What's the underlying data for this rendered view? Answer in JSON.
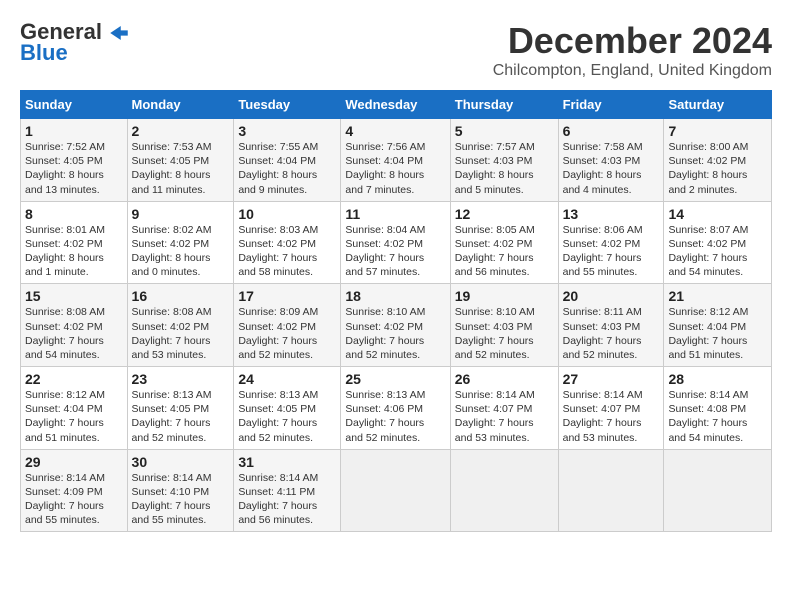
{
  "header": {
    "logo_line1": "General",
    "logo_line2": "Blue",
    "title": "December 2024",
    "subtitle": "Chilcompton, England, United Kingdom"
  },
  "calendar": {
    "days_of_week": [
      "Sunday",
      "Monday",
      "Tuesday",
      "Wednesday",
      "Thursday",
      "Friday",
      "Saturday"
    ],
    "weeks": [
      [
        {
          "day": "1",
          "info": "Sunrise: 7:52 AM\nSunset: 4:05 PM\nDaylight: 8 hours\nand 13 minutes."
        },
        {
          "day": "2",
          "info": "Sunrise: 7:53 AM\nSunset: 4:05 PM\nDaylight: 8 hours\nand 11 minutes."
        },
        {
          "day": "3",
          "info": "Sunrise: 7:55 AM\nSunset: 4:04 PM\nDaylight: 8 hours\nand 9 minutes."
        },
        {
          "day": "4",
          "info": "Sunrise: 7:56 AM\nSunset: 4:04 PM\nDaylight: 8 hours\nand 7 minutes."
        },
        {
          "day": "5",
          "info": "Sunrise: 7:57 AM\nSunset: 4:03 PM\nDaylight: 8 hours\nand 5 minutes."
        },
        {
          "day": "6",
          "info": "Sunrise: 7:58 AM\nSunset: 4:03 PM\nDaylight: 8 hours\nand 4 minutes."
        },
        {
          "day": "7",
          "info": "Sunrise: 8:00 AM\nSunset: 4:02 PM\nDaylight: 8 hours\nand 2 minutes."
        }
      ],
      [
        {
          "day": "8",
          "info": "Sunrise: 8:01 AM\nSunset: 4:02 PM\nDaylight: 8 hours\nand 1 minute."
        },
        {
          "day": "9",
          "info": "Sunrise: 8:02 AM\nSunset: 4:02 PM\nDaylight: 8 hours\nand 0 minutes."
        },
        {
          "day": "10",
          "info": "Sunrise: 8:03 AM\nSunset: 4:02 PM\nDaylight: 7 hours\nand 58 minutes."
        },
        {
          "day": "11",
          "info": "Sunrise: 8:04 AM\nSunset: 4:02 PM\nDaylight: 7 hours\nand 57 minutes."
        },
        {
          "day": "12",
          "info": "Sunrise: 8:05 AM\nSunset: 4:02 PM\nDaylight: 7 hours\nand 56 minutes."
        },
        {
          "day": "13",
          "info": "Sunrise: 8:06 AM\nSunset: 4:02 PM\nDaylight: 7 hours\nand 55 minutes."
        },
        {
          "day": "14",
          "info": "Sunrise: 8:07 AM\nSunset: 4:02 PM\nDaylight: 7 hours\nand 54 minutes."
        }
      ],
      [
        {
          "day": "15",
          "info": "Sunrise: 8:08 AM\nSunset: 4:02 PM\nDaylight: 7 hours\nand 54 minutes."
        },
        {
          "day": "16",
          "info": "Sunrise: 8:08 AM\nSunset: 4:02 PM\nDaylight: 7 hours\nand 53 minutes."
        },
        {
          "day": "17",
          "info": "Sunrise: 8:09 AM\nSunset: 4:02 PM\nDaylight: 7 hours\nand 52 minutes."
        },
        {
          "day": "18",
          "info": "Sunrise: 8:10 AM\nSunset: 4:02 PM\nDaylight: 7 hours\nand 52 minutes."
        },
        {
          "day": "19",
          "info": "Sunrise: 8:10 AM\nSunset: 4:03 PM\nDaylight: 7 hours\nand 52 minutes."
        },
        {
          "day": "20",
          "info": "Sunrise: 8:11 AM\nSunset: 4:03 PM\nDaylight: 7 hours\nand 52 minutes."
        },
        {
          "day": "21",
          "info": "Sunrise: 8:12 AM\nSunset: 4:04 PM\nDaylight: 7 hours\nand 51 minutes."
        }
      ],
      [
        {
          "day": "22",
          "info": "Sunrise: 8:12 AM\nSunset: 4:04 PM\nDaylight: 7 hours\nand 51 minutes."
        },
        {
          "day": "23",
          "info": "Sunrise: 8:13 AM\nSunset: 4:05 PM\nDaylight: 7 hours\nand 52 minutes."
        },
        {
          "day": "24",
          "info": "Sunrise: 8:13 AM\nSunset: 4:05 PM\nDaylight: 7 hours\nand 52 minutes."
        },
        {
          "day": "25",
          "info": "Sunrise: 8:13 AM\nSunset: 4:06 PM\nDaylight: 7 hours\nand 52 minutes."
        },
        {
          "day": "26",
          "info": "Sunrise: 8:14 AM\nSunset: 4:07 PM\nDaylight: 7 hours\nand 53 minutes."
        },
        {
          "day": "27",
          "info": "Sunrise: 8:14 AM\nSunset: 4:07 PM\nDaylight: 7 hours\nand 53 minutes."
        },
        {
          "day": "28",
          "info": "Sunrise: 8:14 AM\nSunset: 4:08 PM\nDaylight: 7 hours\nand 54 minutes."
        }
      ],
      [
        {
          "day": "29",
          "info": "Sunrise: 8:14 AM\nSunset: 4:09 PM\nDaylight: 7 hours\nand 55 minutes."
        },
        {
          "day": "30",
          "info": "Sunrise: 8:14 AM\nSunset: 4:10 PM\nDaylight: 7 hours\nand 55 minutes."
        },
        {
          "day": "31",
          "info": "Sunrise: 8:14 AM\nSunset: 4:11 PM\nDaylight: 7 hours\nand 56 minutes."
        },
        {
          "day": "",
          "info": ""
        },
        {
          "day": "",
          "info": ""
        },
        {
          "day": "",
          "info": ""
        },
        {
          "day": "",
          "info": ""
        }
      ]
    ]
  }
}
